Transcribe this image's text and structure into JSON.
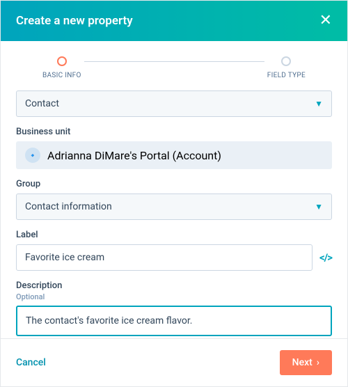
{
  "header": {
    "title": "Create a new property"
  },
  "stepper": {
    "step1": "BASIC INFO",
    "step2": "FIELD TYPE"
  },
  "fields": {
    "object": {
      "value": "Contact"
    },
    "business_unit": {
      "label": "Business unit",
      "value": "Adrianna DiMare's Portal (Account)"
    },
    "group": {
      "label": "Group",
      "value": "Contact information"
    },
    "label": {
      "label": "Label",
      "value": "Favorite ice cream"
    },
    "description": {
      "label": "Description",
      "optional": "Optional",
      "value": "The contact's favorite ice cream flavor."
    }
  },
  "footer": {
    "cancel": "Cancel",
    "next": "Next"
  }
}
